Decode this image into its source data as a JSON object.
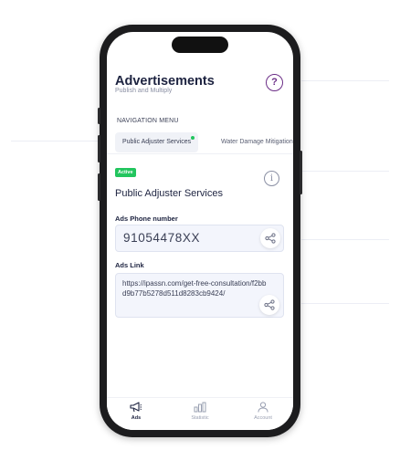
{
  "header": {
    "title": "Advertisements",
    "subtitle": "Publish and Multiply"
  },
  "nav": {
    "label": "NAVIGATION MENU",
    "tabs": [
      {
        "label": "Public Adjuster Services",
        "active": true
      },
      {
        "label": "Water Damage Mitigation",
        "active": false
      }
    ]
  },
  "card": {
    "status": "Active",
    "status_color": "#22c55e",
    "title": "Public Adjuster Services",
    "phone": {
      "label": "Ads Phone number",
      "value": "91054478XX"
    },
    "link": {
      "label": "Ads Link",
      "value": "https://ipassn.com/get-free-consultation/f2bbd9b77b5278d511d8283cb9424/"
    }
  },
  "bottom_nav": [
    {
      "label": "Ads",
      "icon": "megaphone-icon",
      "active": true
    },
    {
      "label": "Statistic",
      "icon": "bar-chart-icon",
      "active": false
    },
    {
      "label": "Account",
      "icon": "user-icon",
      "active": false
    }
  ],
  "colors": {
    "accent": "#6b2d86",
    "field_bg": "#f3f5fc",
    "text": "#1d2340"
  }
}
